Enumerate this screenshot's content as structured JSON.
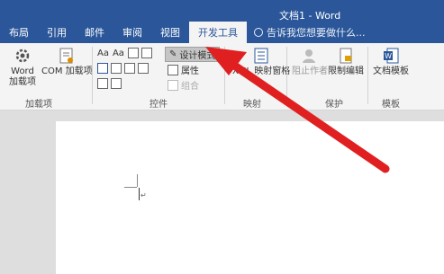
{
  "window": {
    "title": "文档1 - Word"
  },
  "tabs": [
    {
      "label": "布局",
      "active": false
    },
    {
      "label": "引用",
      "active": false
    },
    {
      "label": "邮件",
      "active": false
    },
    {
      "label": "审阅",
      "active": false
    },
    {
      "label": "视图",
      "active": false
    },
    {
      "label": "开发工具",
      "active": true
    }
  ],
  "tellme": {
    "label": "告诉我您想要做什么..."
  },
  "ribbon": {
    "addins": {
      "word_line1": "Word",
      "word_line2": "加载项",
      "com": "COM 加载项",
      "group_label": "加载项"
    },
    "controls": {
      "aa1": "Aa",
      "aa2": "Aa",
      "design_mode": "设计模式",
      "properties": "属性",
      "group_combo": "组合",
      "group_label": "控件"
    },
    "mapping": {
      "xml_pane": "XML 映射窗格",
      "group_label": "映射"
    },
    "protect": {
      "block_authors": "阻止作者",
      "restrict_editing": "限制编辑",
      "group_label": "保护"
    },
    "templates": {
      "doc_template": "文档模板",
      "group_label": "模板"
    }
  },
  "document": {
    "paragraph_mark": "↵"
  },
  "colors": {
    "title_bar": "#2b579a",
    "arrow": "#e02020",
    "ribbon_bg": "#f4f4f4"
  }
}
